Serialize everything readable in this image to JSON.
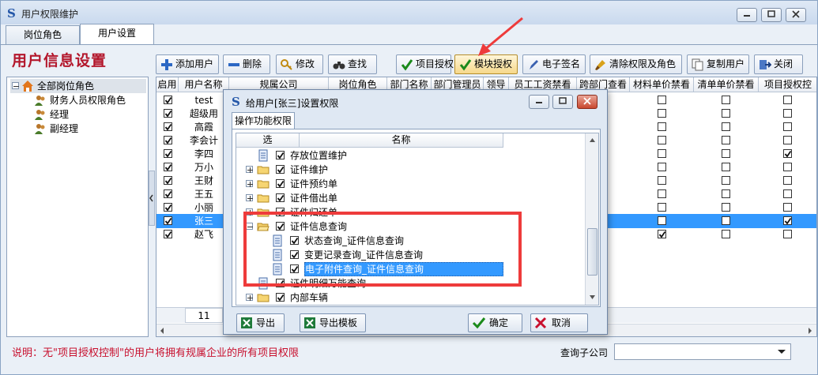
{
  "window": {
    "title": "用户权限维护"
  },
  "tabs": [
    "岗位角色",
    "用户设置"
  ],
  "active_tab": 1,
  "page_title": "用户信息设置",
  "toolbar": [
    "添加用户",
    "删除",
    "修改",
    "查找",
    "项目授权",
    "模块授权",
    "电子签名",
    "清除权限及角色",
    "复制用户",
    "关闭"
  ],
  "tree": {
    "root": "全部岗位角色",
    "children": [
      "财务人员权限角色",
      "经理",
      "副经理"
    ]
  },
  "grid": {
    "columns": [
      "启用",
      "用户名称",
      "规属公司",
      "岗位角色",
      "部门名称",
      "部门管理员",
      "领导",
      "员工工资禁看",
      "跨部门查看",
      "材料单价禁看",
      "清单单价禁看",
      "项目授权控"
    ],
    "rows": [
      {
        "enabled": true,
        "name": "test",
        "mat": false,
        "list": false,
        "proj": false
      },
      {
        "enabled": true,
        "name": "超级用",
        "mat": false,
        "list": false,
        "proj": false
      },
      {
        "enabled": true,
        "name": "高霞",
        "mat": false,
        "list": false,
        "proj": false
      },
      {
        "enabled": true,
        "name": "李会计",
        "mat": false,
        "list": false,
        "proj": false
      },
      {
        "enabled": true,
        "name": "李四",
        "mat": false,
        "list": false,
        "proj": true
      },
      {
        "enabled": true,
        "name": "万小",
        "mat": false,
        "list": false,
        "proj": false
      },
      {
        "enabled": true,
        "name": "王财",
        "mat": false,
        "list": false,
        "proj": false
      },
      {
        "enabled": true,
        "name": "王五",
        "mat": false,
        "list": false,
        "proj": false
      },
      {
        "enabled": true,
        "name": "小丽",
        "mat": false,
        "list": false,
        "proj": false
      },
      {
        "enabled": true,
        "name": "张三",
        "mat": false,
        "list": false,
        "proj": true,
        "selected": true
      },
      {
        "enabled": true,
        "name": "赵飞",
        "mat": true,
        "list": false,
        "proj": false
      }
    ],
    "footer_count": "11"
  },
  "note": "说明：无\"项目授权控制\"的用户将拥有规属企业的所有项目权限",
  "sub_company_label": "查询子公司",
  "sub_company_value": "",
  "dialog": {
    "title": "给用户[张三]设置权限",
    "tab": "操作功能权限",
    "headers": [
      "选",
      "名称"
    ],
    "items": [
      {
        "name": "存放位置维护",
        "type": "doc",
        "checked": true
      },
      {
        "name": "证件维护",
        "type": "folder",
        "checked": true
      },
      {
        "name": "证件预约单",
        "type": "folder",
        "checked": true
      },
      {
        "name": "证件借出单",
        "type": "folder",
        "checked": true
      },
      {
        "name": "证件归还单",
        "type": "folder",
        "checked": true
      },
      {
        "name": "证件信息查询",
        "type": "folder-open",
        "checked": true
      },
      {
        "name": "状态查询_证件信息查询",
        "type": "doc",
        "checked": true
      },
      {
        "name": "变更记录查询_证件信息查询",
        "type": "doc",
        "checked": true
      },
      {
        "name": "电子附件查询_证件信息查询",
        "type": "doc",
        "checked": true,
        "selected": true
      },
      {
        "name": "证件明细万能查询",
        "type": "doc",
        "checked": true
      },
      {
        "name": "内部车辆",
        "type": "folder",
        "checked": true
      }
    ],
    "buttons": [
      "导出",
      "导出模板",
      "确定",
      "取消"
    ]
  },
  "colors": {
    "accent_red": "#ee3b3b",
    "title_red": "#b3162b",
    "selection": "#3399ff"
  }
}
